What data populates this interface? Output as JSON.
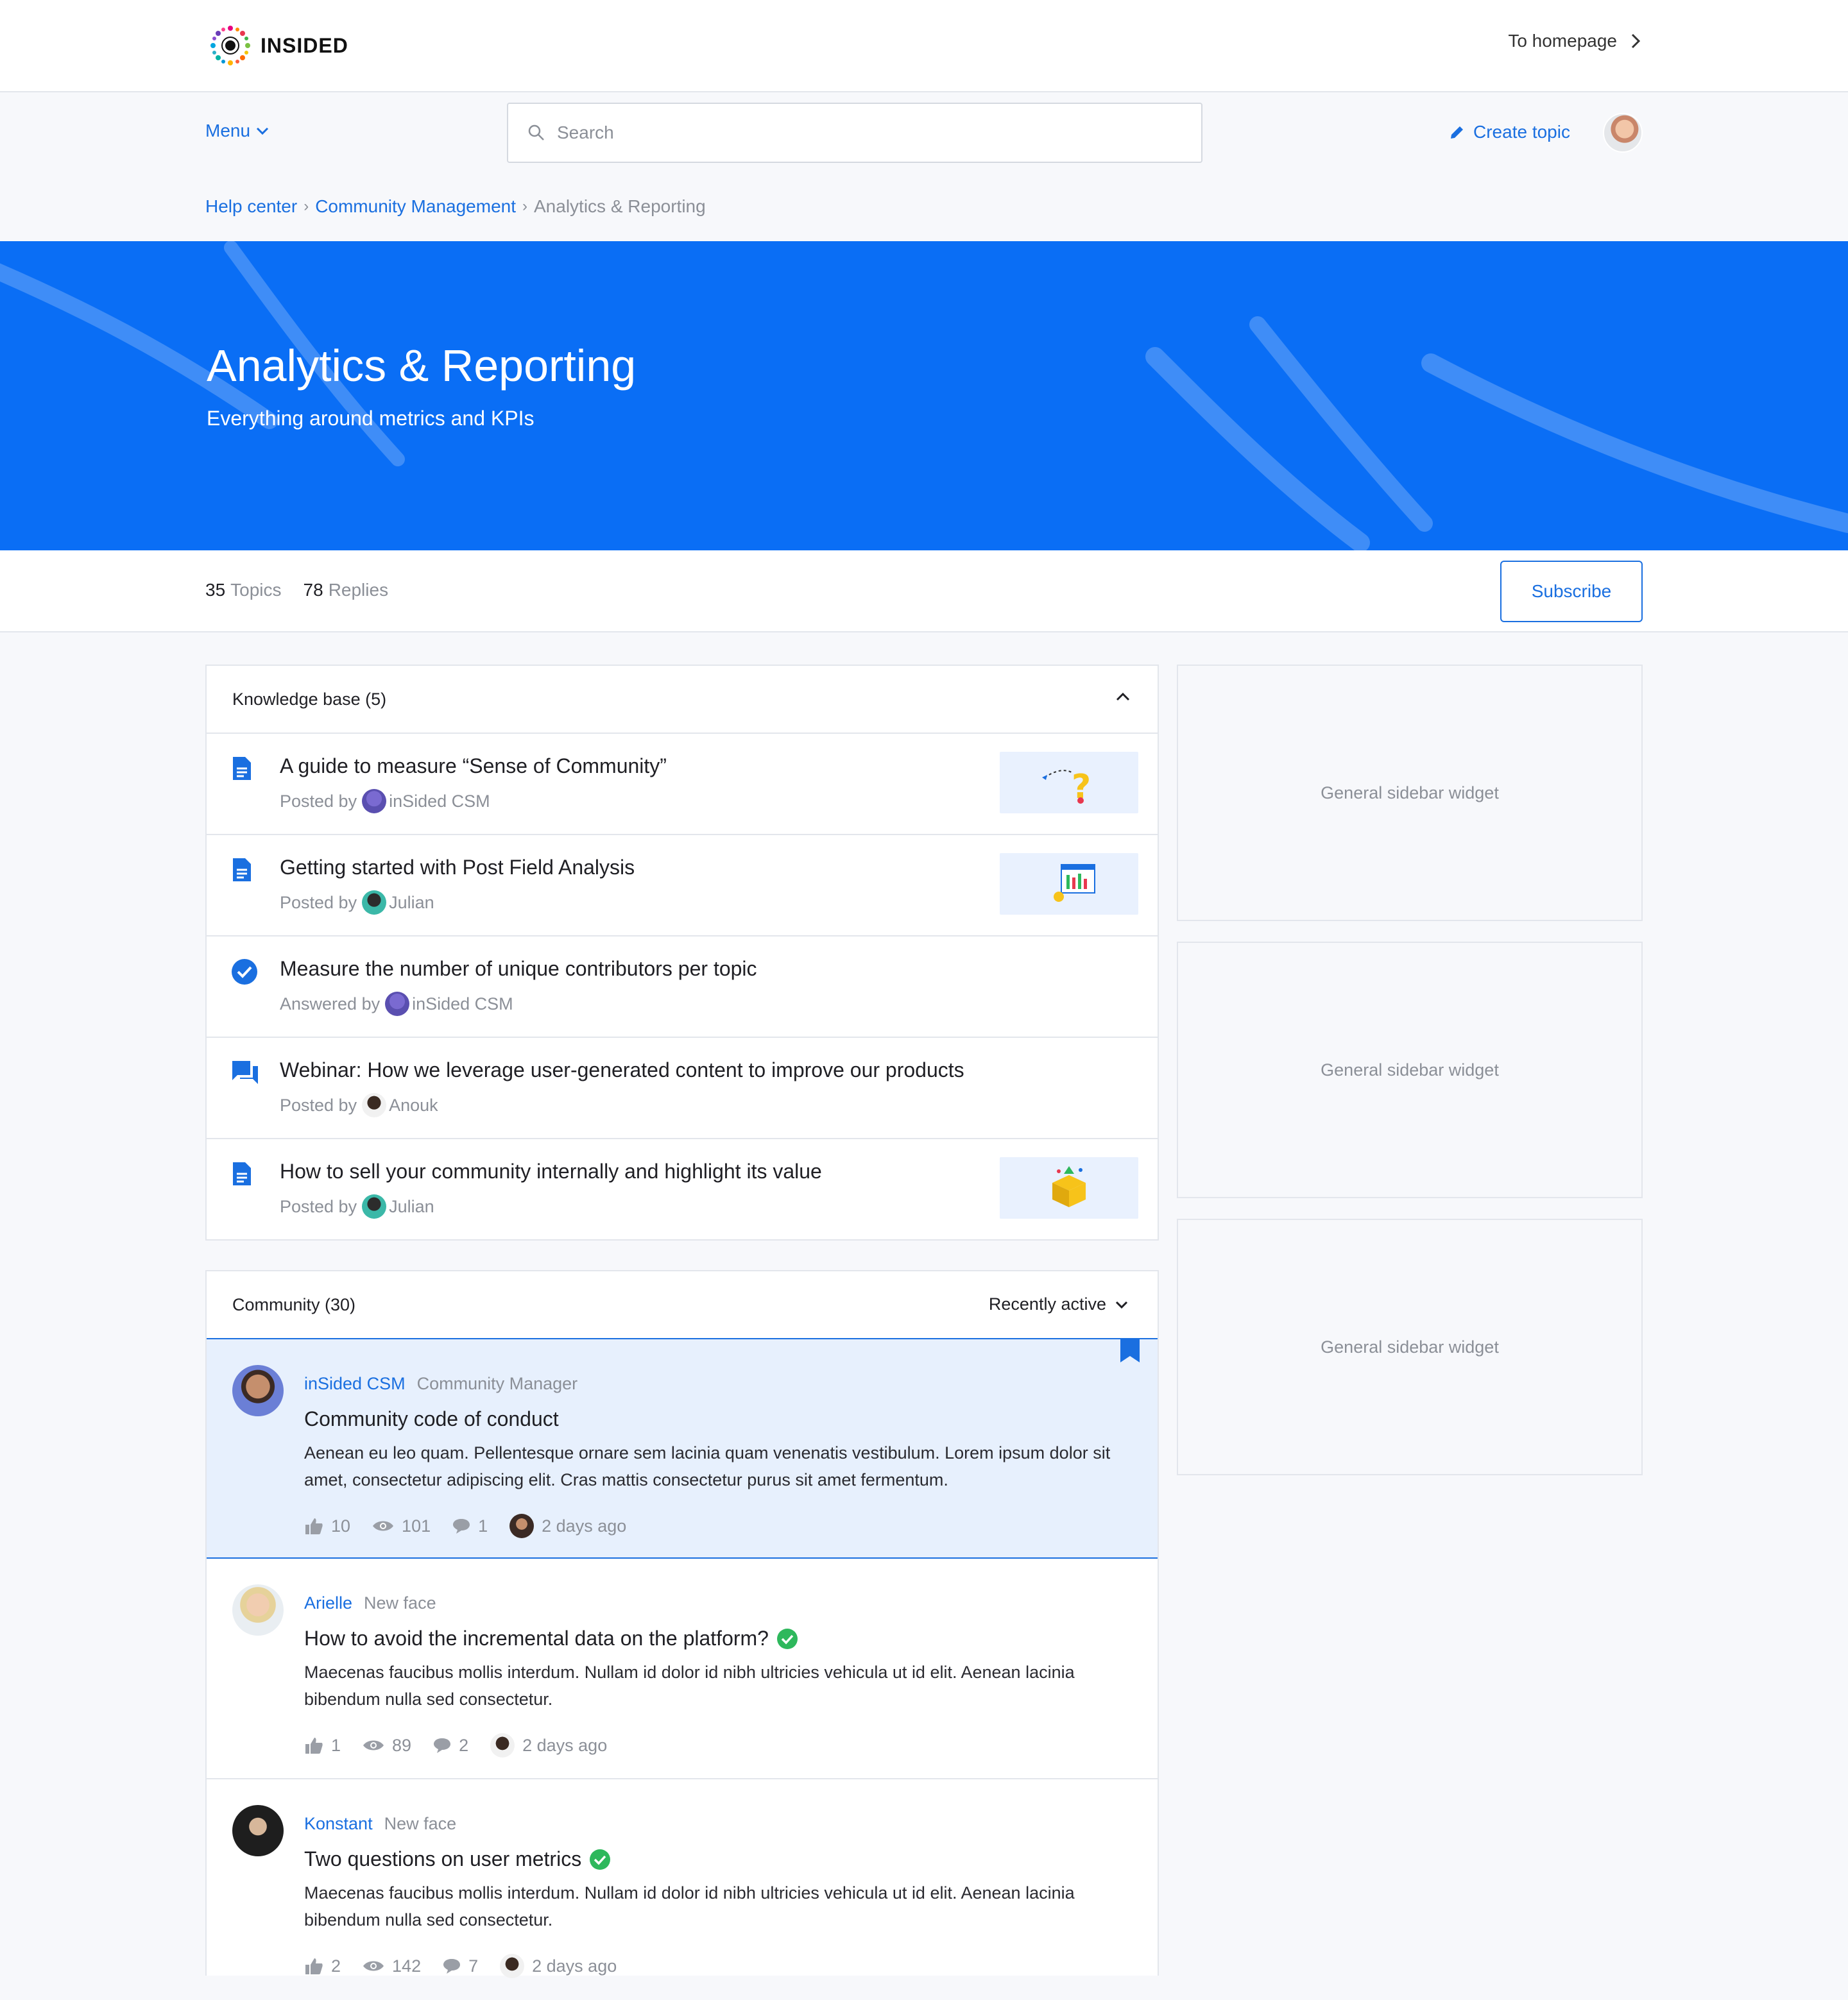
{
  "brand": {
    "logo_text": "INSIDED"
  },
  "topbar": {
    "to_homepage": "To homepage"
  },
  "nav": {
    "menu_label": "Menu",
    "search_placeholder": "Search",
    "create_topic": "Create topic"
  },
  "breadcrumb": [
    "Help center",
    "Community Management",
    "Analytics & Reporting"
  ],
  "hero": {
    "title": "Analytics & Reporting",
    "subtitle": "Everything around metrics and KPIs",
    "background": "#0a6ef5"
  },
  "stats": {
    "topics_count": "35",
    "topics_label": "Topics",
    "replies_count": "78",
    "replies_label": "Replies",
    "subscribe_label": "Subscribe"
  },
  "knowledge_base": {
    "header": "Knowledge base (5)",
    "items": [
      {
        "icon": "document-icon",
        "title": "A guide to measure “Sense of Community”",
        "meta_prefix": "Posted by",
        "author": "inSided CSM",
        "has_thumbnail": true
      },
      {
        "icon": "document-icon",
        "title": "Getting started with Post Field Analysis",
        "meta_prefix": "Posted by",
        "author": "Julian",
        "has_thumbnail": true
      },
      {
        "icon": "check-circle-icon",
        "title": "Measure the number of unique contributors per topic",
        "meta_prefix": "Answered by",
        "author": "inSided CSM",
        "has_thumbnail": false
      },
      {
        "icon": "chat-bubbles-icon",
        "title": "Webinar: How we leverage user-generated content to improve our products",
        "meta_prefix": "Posted by",
        "author": "Anouk",
        "has_thumbnail": false
      },
      {
        "icon": "document-icon",
        "title": "How to sell your community internally and highlight its value",
        "meta_prefix": "Posted by",
        "author": "Julian",
        "has_thumbnail": true
      }
    ]
  },
  "community": {
    "header": "Community (30)",
    "sort_label": "Recently active",
    "posts": [
      {
        "author": "inSided CSM",
        "role": "Community Manager",
        "pinned": true,
        "answered": false,
        "title": "Community code of conduct",
        "body": "Aenean eu leo quam. Pellentesque ornare sem lacinia quam venenatis vestibulum. Lorem ipsum dolor sit amet, consectetur adipiscing elit. Cras mattis consectetur purus sit amet fermentum.",
        "likes": "10",
        "views": "101",
        "replies": "1",
        "time": "2 days ago"
      },
      {
        "author": "Arielle",
        "role": "New face",
        "pinned": false,
        "answered": true,
        "title": "How to avoid the incremental data on the platform?",
        "body": "Maecenas faucibus mollis interdum. Nullam id dolor id nibh ultricies vehicula ut id elit. Aenean lacinia bibendum nulla sed consectetur.",
        "likes": "1",
        "views": "89",
        "replies": "2",
        "time": "2 days ago"
      },
      {
        "author": "Konstant",
        "role": "New face",
        "pinned": false,
        "answered": true,
        "title": "Two questions on user metrics",
        "body": "Maecenas faucibus mollis interdum. Nullam id dolor id nibh ultricies vehicula ut id elit. Aenean lacinia bibendum nulla sed consectetur.",
        "likes": "2",
        "views": "142",
        "replies": "7",
        "time": "2 days ago"
      }
    ]
  },
  "sidebar": {
    "widgets": [
      "General sidebar widget",
      "General sidebar widget",
      "General sidebar widget"
    ]
  },
  "colors": {
    "accent": "#1a6fe0",
    "muted": "#8b8f97",
    "answered": "#2eb85c",
    "pinned_bg": "#e7f0fd"
  }
}
